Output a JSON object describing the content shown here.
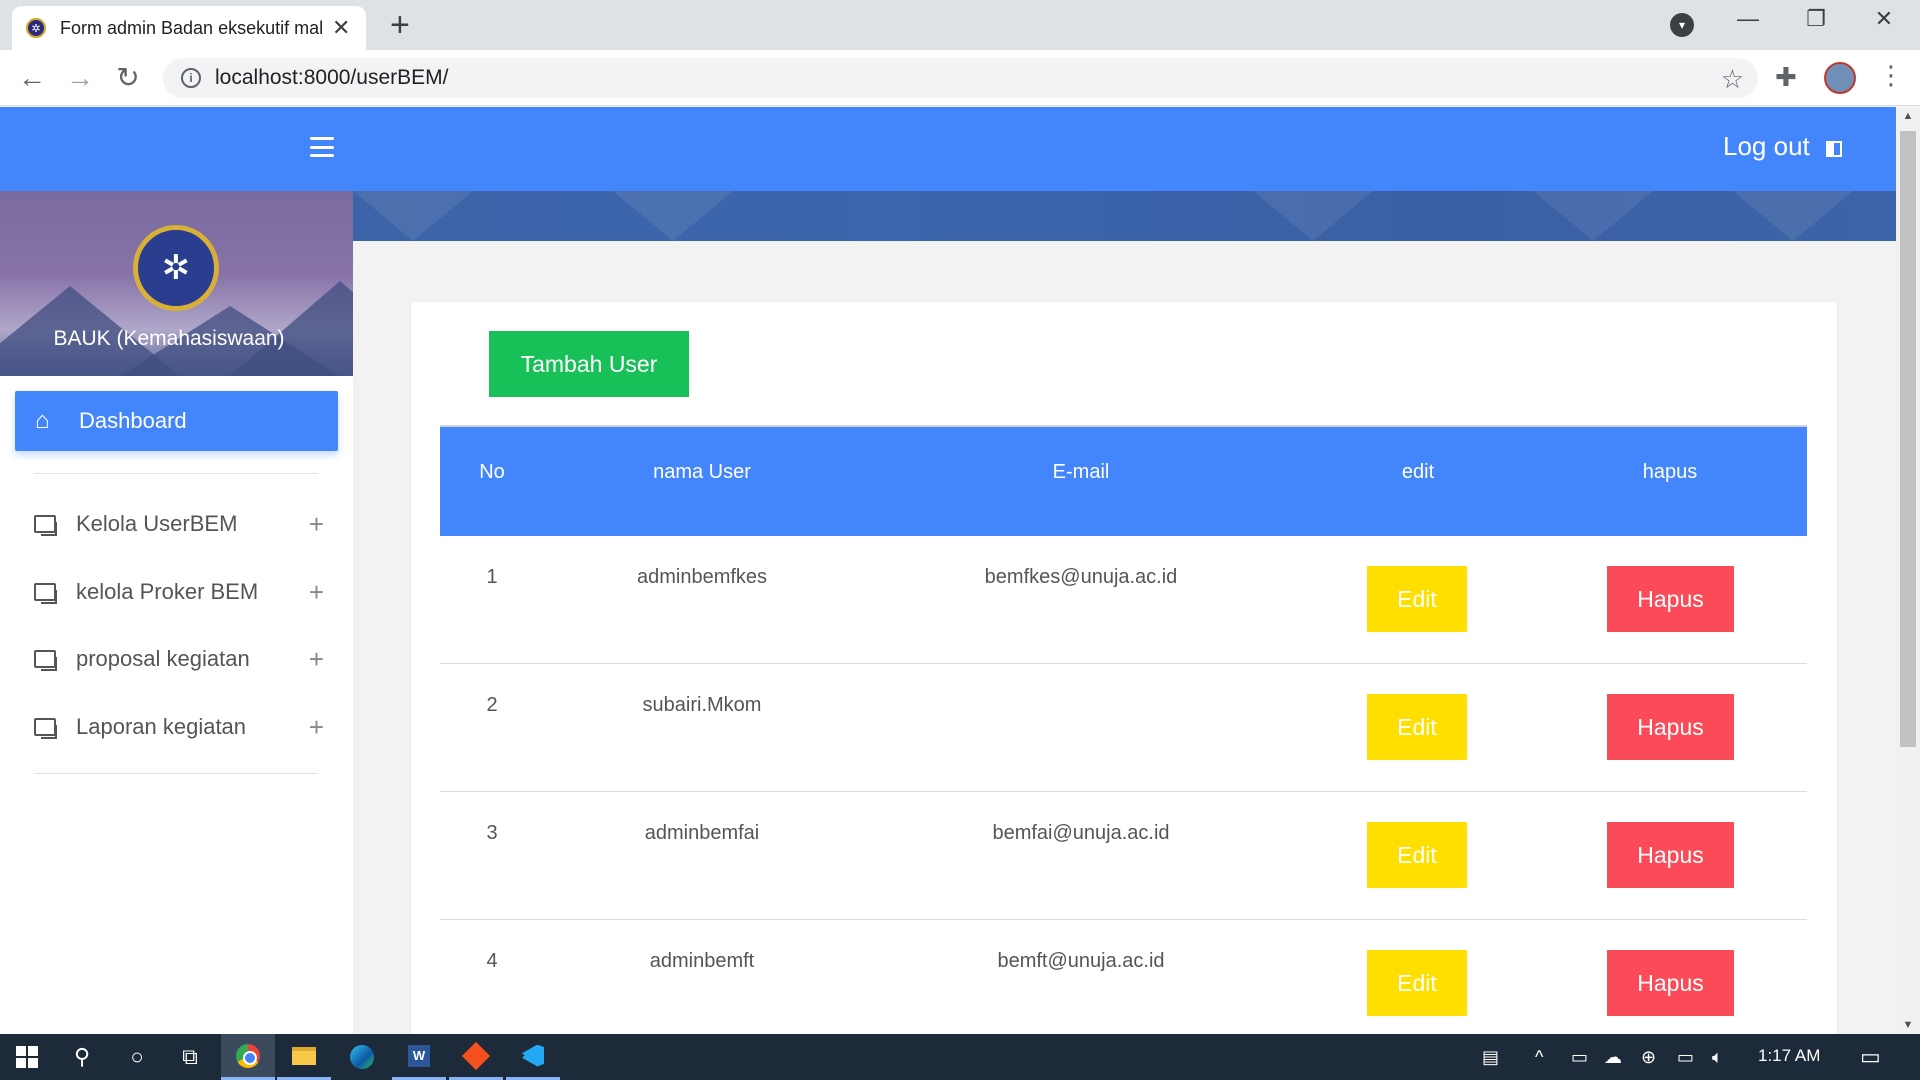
{
  "browser": {
    "tab_title": "Form admin Badan eksekutif mahasiswa",
    "tab_close": "✕",
    "new_tab": "+",
    "url": "localhost:8000/userBEM/",
    "window_controls": {
      "minimize": "—",
      "restore": "❐",
      "close": "✕"
    }
  },
  "topnav": {
    "logout_label": "Log out"
  },
  "sidebar": {
    "title": "BAUK (Kemahasiswaan)",
    "dashboard_label": "Dashboard",
    "items": [
      {
        "label": "Kelola UserBEM",
        "icon": "copy-icon"
      },
      {
        "label": "kelola Proker BEM",
        "icon": "copy-icon"
      },
      {
        "label": "proposal kegiatan",
        "icon": "copy-icon"
      },
      {
        "label": "Laporan kegiatan",
        "icon": "copy-icon"
      }
    ],
    "expand_symbol": "+"
  },
  "content": {
    "add_button": "Tambah User",
    "columns": [
      "No",
      "nama User",
      "E-mail",
      "edit",
      "hapus"
    ],
    "rows": [
      {
        "no": "1",
        "name": "adminbemfkes",
        "email": "bemfkes@unuja.ac.id",
        "edit": "Edit",
        "delete": "Hapus"
      },
      {
        "no": "2",
        "name": "subairi.Mkom",
        "email": "",
        "edit": "Edit",
        "delete": "Hapus"
      },
      {
        "no": "3",
        "name": "adminbemfai",
        "email": "bemfai@unuja.ac.id",
        "edit": "Edit",
        "delete": "Hapus"
      },
      {
        "no": "4",
        "name": "adminbemft",
        "email": "bemft@unuja.ac.id",
        "edit": "Edit",
        "delete": "Hapus"
      }
    ]
  },
  "taskbar": {
    "time": "1:17 AM"
  },
  "colors": {
    "primary": "#4386fc",
    "success": "#18c157",
    "warning": "#fedf00",
    "danger": "#fc4b58"
  }
}
